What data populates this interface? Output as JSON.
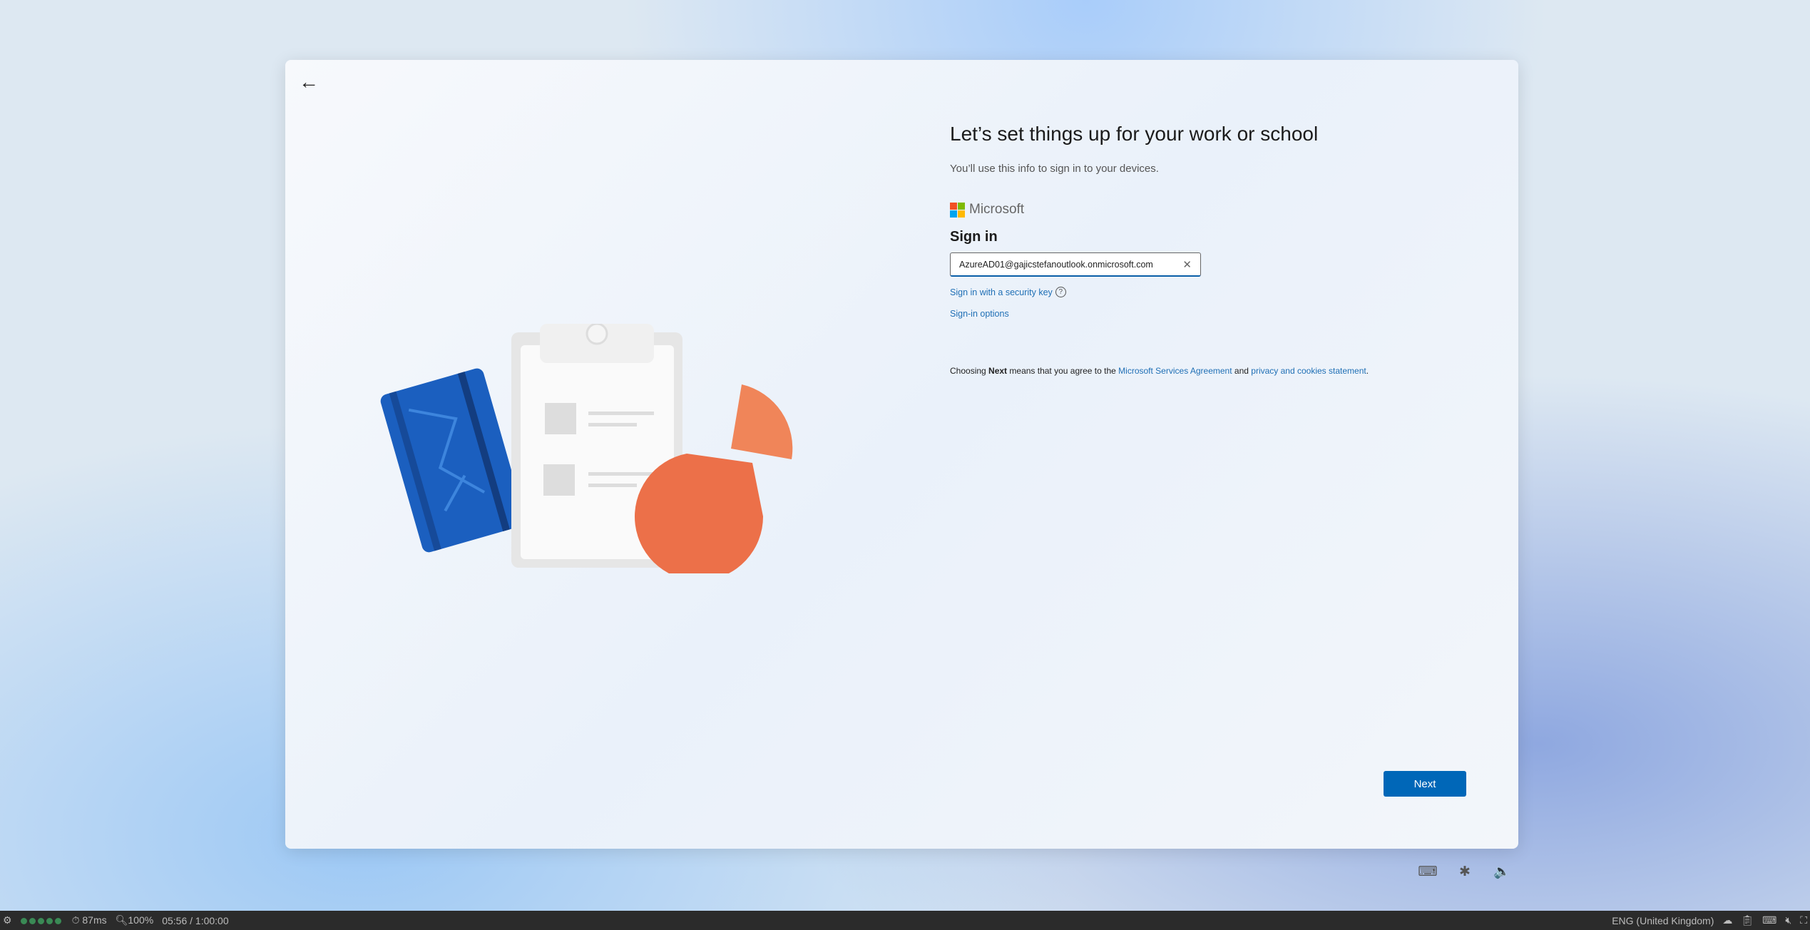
{
  "card": {
    "title": "Let’s set things up for your work or school",
    "subtitle": "You’ll use this info to sign in to your devices.",
    "brand": "Microsoft",
    "signin_heading": "Sign in",
    "email_value": "AzureAD01@gajicstefanoutlook.onmicrosoft.com",
    "security_key_link": "Sign in with a security key",
    "signin_options_link": "Sign-in options",
    "terms": {
      "prefix": "Choosing ",
      "bold": "Next",
      "middle": " means that you agree to the ",
      "link1": "Microsoft Services Agreement",
      "and": " and ",
      "link2": "privacy and cookies statement",
      "suffix": "."
    },
    "next_label": "Next",
    "logo_colors": [
      "#f25022",
      "#7fba00",
      "#00a4ef",
      "#ffb900"
    ]
  },
  "status_bar": {
    "dots": 5,
    "latency": "87ms",
    "zoom": "100%",
    "time": "05:56 / 1:00:00",
    "language": "ENG (United Kingdom)"
  }
}
